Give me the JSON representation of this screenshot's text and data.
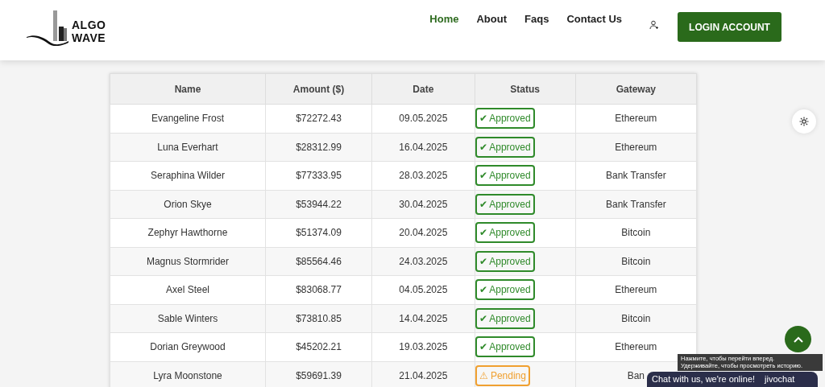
{
  "header": {
    "logo": {
      "line_1": "ALGO",
      "line_2": "WAVE"
    },
    "nav": [
      {
        "label": "Home",
        "selected": true
      },
      {
        "label": "About",
        "selected": false
      },
      {
        "label": "Faqs",
        "selected": false
      },
      {
        "label": "Contact Us",
        "selected": false
      }
    ],
    "login_button": "LOGIN ACCOUNT"
  },
  "table": {
    "columns": [
      "Name",
      "Amount ($)",
      "Date",
      "Status",
      "Gateway"
    ],
    "rows": [
      {
        "name": "Evangeline Frost",
        "amount": "$72272.43",
        "date": "09.05.2025",
        "status": {
          "kind": "approved",
          "label": "✔ Approved"
        },
        "gateway": "Ethereum"
      },
      {
        "name": "Luna Everhart",
        "amount": "$28312.99",
        "date": "16.04.2025",
        "status": {
          "kind": "approved",
          "label": "✔ Approved"
        },
        "gateway": "Ethereum"
      },
      {
        "name": "Seraphina Wilder",
        "amount": "$77333.95",
        "date": "28.03.2025",
        "status": {
          "kind": "approved",
          "label": "✔ Approved"
        },
        "gateway": "Bank Transfer"
      },
      {
        "name": "Orion Skye",
        "amount": "$53944.22",
        "date": "30.04.2025",
        "status": {
          "kind": "approved",
          "label": "✔ Approved"
        },
        "gateway": "Bank Transfer"
      },
      {
        "name": "Zephyr Hawthorne",
        "amount": "$51374.09",
        "date": "20.04.2025",
        "status": {
          "kind": "approved",
          "label": "✔ Approved"
        },
        "gateway": "Bitcoin"
      },
      {
        "name": "Magnus Stormrider",
        "amount": "$85564.46",
        "date": "24.03.2025",
        "status": {
          "kind": "approved",
          "label": "✔ Approved"
        },
        "gateway": "Bitcoin"
      },
      {
        "name": "Axel Steel",
        "amount": "$83068.77",
        "date": "04.05.2025",
        "status": {
          "kind": "approved",
          "label": "✔ Approved"
        },
        "gateway": "Ethereum"
      },
      {
        "name": "Sable Winters",
        "amount": "$73810.85",
        "date": "14.04.2025",
        "status": {
          "kind": "approved",
          "label": "✔ Approved"
        },
        "gateway": "Bitcoin"
      },
      {
        "name": "Dorian Greywood",
        "amount": "$45202.21",
        "date": "19.03.2025",
        "status": {
          "kind": "approved",
          "label": "✔ Approved"
        },
        "gateway": "Ethereum"
      },
      {
        "name": "Lyra Moonstone",
        "amount": "$59691.39",
        "date": "21.04.2025",
        "status": {
          "kind": "pending",
          "label": "⚠ Pending"
        },
        "gateway": "Ban"
      }
    ]
  },
  "chat": {
    "text": "Chat with us, we're online!",
    "brand": "jivochat"
  },
  "tooltip": {
    "lines": [
      "Нажмите, чтобы перейти вперед.",
      "Удерживайте, чтобы просмотреть историю."
    ]
  }
}
